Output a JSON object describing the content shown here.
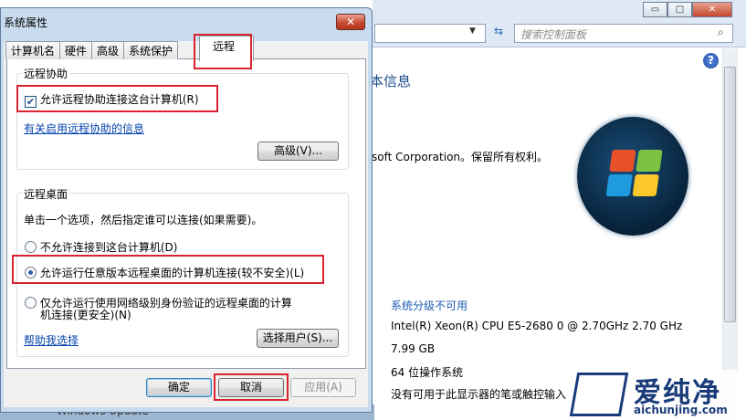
{
  "background": {
    "search_placeholder": "搜索控制面板",
    "heading": "本信息",
    "copyright": "soft Corporation。保留所有权利。",
    "rating_link": "系统分级不可用",
    "cpu": "Intel(R) Xeon(R) CPU E5-2680 0 @ 2.70GHz   2.70 GHz",
    "ram": "7.99 GB",
    "os_type": "64 位操作系统",
    "pen": "没有可用于此显示器的笔或触控输入",
    "windows_update": "Windows Update",
    "window_buttons": {
      "min": "▭",
      "max": "□",
      "close": "✕"
    }
  },
  "watermark": {
    "text": "爱纯净",
    "url": "aichunjing.com"
  },
  "dialog": {
    "title": "系统属性",
    "close_label": "✕",
    "tabs": [
      "计算机名",
      "硬件",
      "高级",
      "系统保护"
    ],
    "active_tab": "远程",
    "remote_assist": {
      "group_label": "远程协助",
      "allow_label": "允许远程协助连接这台计算机(R)",
      "allow_checked": true,
      "info_link": "有关启用远程协助的信息",
      "advanced_button": "高级(V)..."
    },
    "remote_desktop": {
      "group_label": "远程桌面",
      "instruction": "单击一个选项，然后指定谁可以连接(如果需要)。",
      "option_none": "不允许连接到这台计算机(D)",
      "option_any": "允许运行任意版本远程桌面的计算机连接(较不安全)(L)",
      "option_nla_line1": "仅允许运行使用网络级别身份验证的远程桌面的计算",
      "option_nla_line2": "机连接(更安全)(N)",
      "selected": "any",
      "help_link": "帮助我选择",
      "select_users_button": "选择用户(S)..."
    },
    "buttons": {
      "ok": "确定",
      "cancel": "取消",
      "apply": "应用(A)"
    }
  }
}
